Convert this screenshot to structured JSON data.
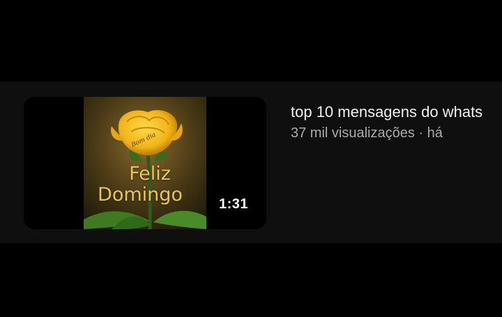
{
  "video": {
    "title": "top 10 mensagens do whats",
    "stats": "37 mil visualizações · há",
    "duration": "1:31",
    "thumbnail": {
      "line1": "Feliz",
      "line2": "Domingo",
      "signature": "Bom dia",
      "image": "yellow-rose"
    }
  },
  "colors": {
    "background": "#000000",
    "row_background": "#0f0f0f",
    "title_text": "#f1f1f1",
    "stats_text": "#aaaaaa",
    "greeting_text": "#e6c85a",
    "rose": "#f2b418"
  }
}
